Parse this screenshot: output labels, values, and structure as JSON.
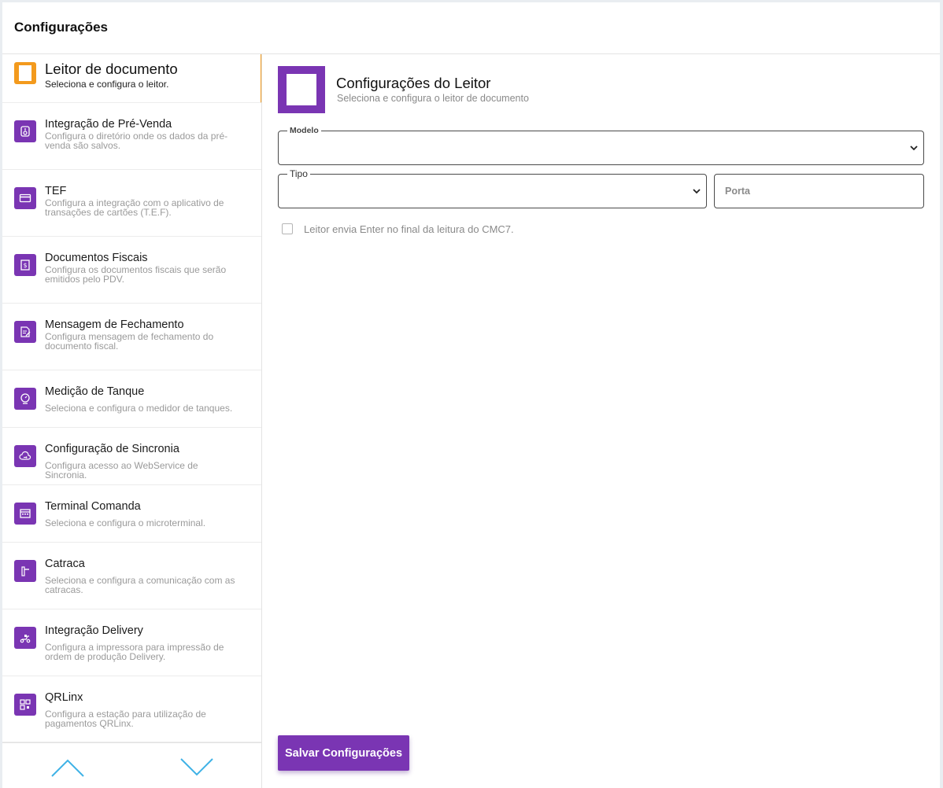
{
  "header": {
    "title": "Configurações"
  },
  "colors": {
    "accent": "#7a35b3",
    "active": "#f39a1d"
  },
  "sidebar": {
    "items": [
      {
        "name": "Leitor de documento",
        "desc": "Seleciona e configura o leitor.",
        "icon": "document-reader-icon"
      },
      {
        "name": "Integração de Pré-Venda",
        "desc": "Configura o diretório onde os dados da pré-venda são salvos.",
        "icon": "folder-integration-icon"
      },
      {
        "name": "TEF",
        "desc": "Configura a integração com o aplicativo de transações de cartões (T.E.F).",
        "icon": "credit-card-icon"
      },
      {
        "name": "Documentos Fiscais",
        "desc": "Configura os documentos fiscais que serão emitidos pelo PDV.",
        "icon": "fiscal-document-icon"
      },
      {
        "name": "Mensagem de Fechamento",
        "desc": "Configura mensagem de fechamento do documento fiscal.",
        "icon": "message-edit-icon"
      },
      {
        "name": "Medição de Tanque",
        "desc": "Seleciona e configura o medidor de tanques.",
        "icon": "gauge-icon"
      },
      {
        "name": "Configuração de Sincronia",
        "desc": "Configura acesso ao WebService de Sincronia.",
        "icon": "cloud-sync-icon"
      },
      {
        "name": "Terminal Comanda",
        "desc": "Seleciona e configura o microterminal.",
        "icon": "terminal-icon"
      },
      {
        "name": "Catraca",
        "desc": "Seleciona e configura a comunicação com as catracas.",
        "icon": "turnstile-icon"
      },
      {
        "name": "Integração Delivery",
        "desc": "Configura a impressora para impressão de ordem de produção Delivery.",
        "icon": "delivery-scooter-icon"
      },
      {
        "name": "QRLinx",
        "desc": "Configura a estação para utilização de pagamentos QRLinx.",
        "icon": "qr-code-icon"
      }
    ]
  },
  "main": {
    "title": "Configurações do Leitor",
    "subtitle": "Seleciona e configura o leitor de documento",
    "modelo_label": "Modelo",
    "modelo_value": "",
    "tipo_label": "Tipo",
    "tipo_value": "",
    "porta_placeholder": "Porta",
    "porta_value": "",
    "checkbox_label": "Leitor envia Enter no final da leitura do CMC7.",
    "checkbox_checked": false,
    "save_label": "Salvar Configurações"
  }
}
